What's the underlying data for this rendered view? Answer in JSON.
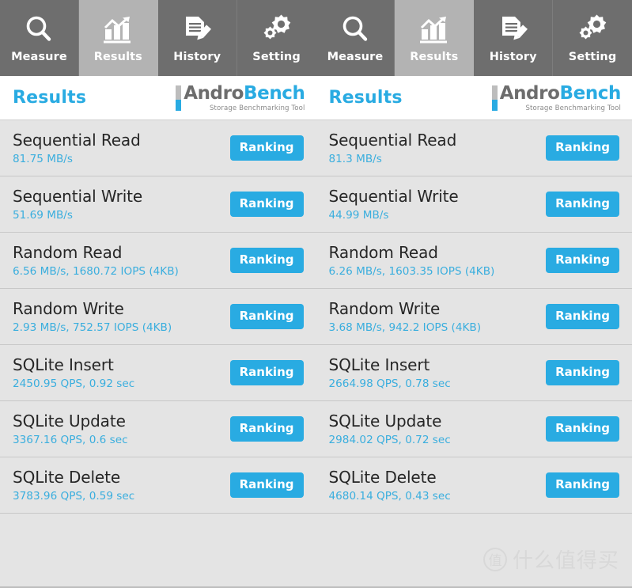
{
  "colors": {
    "accent_blue": "#29abe2",
    "value_blue": "#3aaede",
    "tabbar_bg": "#6e6e6e",
    "tab_active_bg": "#b3b3b3",
    "row_bg": "#e4e4e4",
    "header_bg": "#ffffff",
    "row_divider": "#c8c8c8",
    "logo_grey": "#6d6d6d"
  },
  "panels": [
    {
      "tabs": [
        {
          "label": "Measure",
          "icon": "magnifier-icon",
          "active": false
        },
        {
          "label": "Results",
          "icon": "bar-chart-trend-icon",
          "active": true
        },
        {
          "label": "History",
          "icon": "document-pencil-icon",
          "active": false
        },
        {
          "label": "Setting",
          "icon": "gears-icon",
          "active": false
        }
      ],
      "header": {
        "title": "Results",
        "logo_main_primary": "Andro",
        "logo_main_secondary": "Bench",
        "logo_tagline": "Storage Benchmarking Tool"
      },
      "rows": [
        {
          "title": "Sequential Read",
          "value": "81.75 MB/s",
          "button": "Ranking"
        },
        {
          "title": "Sequential Write",
          "value": "51.69 MB/s",
          "button": "Ranking"
        },
        {
          "title": "Random Read",
          "value": "6.56 MB/s, 1680.72 IOPS (4KB)",
          "button": "Ranking"
        },
        {
          "title": "Random Write",
          "value": "2.93 MB/s, 752.57 IOPS (4KB)",
          "button": "Ranking"
        },
        {
          "title": "SQLite Insert",
          "value": "2450.95 QPS, 0.92 sec",
          "button": "Ranking"
        },
        {
          "title": "SQLite Update",
          "value": "3367.16 QPS, 0.6 sec",
          "button": "Ranking"
        },
        {
          "title": "SQLite Delete",
          "value": "3783.96 QPS, 0.59 sec",
          "button": "Ranking"
        }
      ]
    },
    {
      "tabs": [
        {
          "label": "Measure",
          "icon": "magnifier-icon",
          "active": false
        },
        {
          "label": "Results",
          "icon": "bar-chart-trend-icon",
          "active": true
        },
        {
          "label": "History",
          "icon": "document-pencil-icon",
          "active": false
        },
        {
          "label": "Setting",
          "icon": "gears-icon",
          "active": false
        }
      ],
      "header": {
        "title": "Results",
        "logo_main_primary": "Andro",
        "logo_main_secondary": "Bench",
        "logo_tagline": "Storage Benchmarking Tool"
      },
      "rows": [
        {
          "title": "Sequential Read",
          "value": "81.3 MB/s",
          "button": "Ranking"
        },
        {
          "title": "Sequential Write",
          "value": "44.99 MB/s",
          "button": "Ranking"
        },
        {
          "title": "Random Read",
          "value": "6.26 MB/s, 1603.35 IOPS (4KB)",
          "button": "Ranking"
        },
        {
          "title": "Random Write",
          "value": "3.68 MB/s, 942.2 IOPS (4KB)",
          "button": "Ranking"
        },
        {
          "title": "SQLite Insert",
          "value": "2664.98 QPS, 0.78 sec",
          "button": "Ranking"
        },
        {
          "title": "SQLite Update",
          "value": "2984.02 QPS, 0.72 sec",
          "button": "Ranking"
        },
        {
          "title": "SQLite Delete",
          "value": "4680.14 QPS, 0.43 sec",
          "button": "Ranking"
        }
      ]
    }
  ],
  "watermark": {
    "badge": "值",
    "text": "什么值得买"
  }
}
